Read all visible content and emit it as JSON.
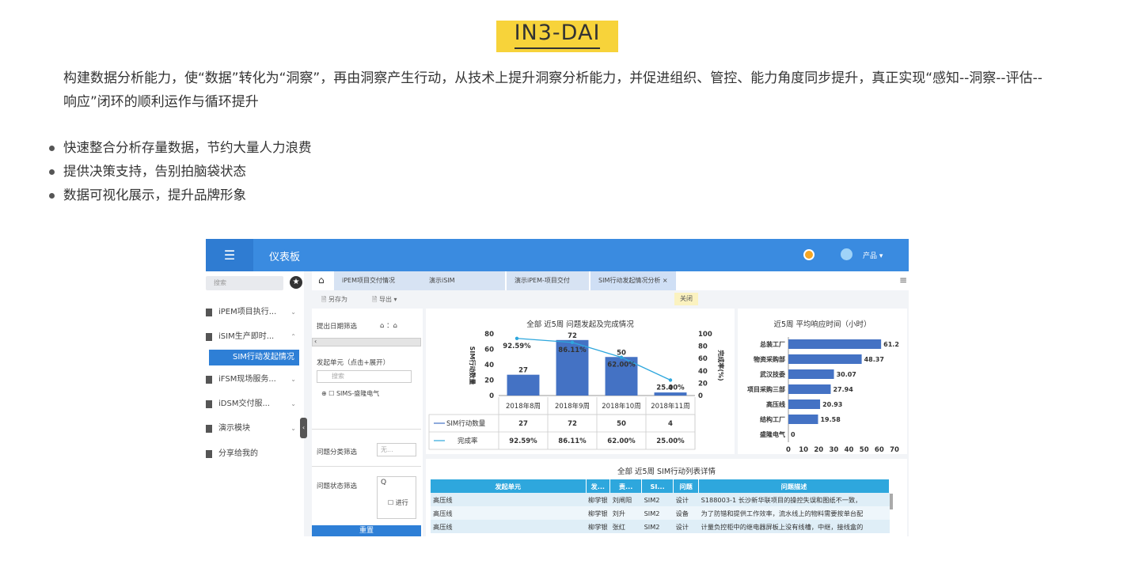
{
  "page": {
    "title": "IN3-DAI",
    "intro": "构建数据分析能力，使“数据”转化为“洞察”，再由洞察产生行动，从技术上提升洞察分析能力，并促进组织、管控、能力角度同步提升，真正实现“感知--洞察--评估--响应”闭环的顺利运作与循环提升",
    "bullets": [
      "快速整合分析存量数据，节约大量人力浪费",
      "提供决策支持，告别拍脑袋状态",
      "数据可视化展示，提升品牌形象"
    ]
  },
  "dashboard": {
    "menu_icon": "☰",
    "app_title": "仪表板",
    "user": "产品 ▾",
    "search_placeholder": "搜索",
    "star_icon": "★",
    "sidebar": [
      {
        "label": "iPEM项目执行...",
        "arrow": "⌄"
      },
      {
        "label": "iSIM生产即时...",
        "arrow": "⌃"
      },
      {
        "label": "SIM行动发起情况分...",
        "arrow": ""
      },
      {
        "label": "iFSM现场服务...",
        "arrow": "⌄"
      },
      {
        "label": "iDSM交付服...",
        "arrow": "⌄"
      },
      {
        "label": "演示模块",
        "arrow": "⌄"
      },
      {
        "label": "分享给我的",
        "arrow": ""
      }
    ],
    "collapse_icon": "‹",
    "home_icon": "⌂",
    "tabs": [
      "iPEM项目交付情况",
      "演示iSIM",
      "演示iPEM-项目交付",
      "SIM行动发起情况分析 ×"
    ],
    "hamburger": "≡",
    "toolbar": {
      "save_as": "🗎 另存为",
      "export": "🗎 导出 ▾"
    },
    "close_label": "关闭",
    "filters": {
      "date_label": "提出日期筛选",
      "date_value": "⌂ ：⌂",
      "scroll_left": "‹",
      "unit_label": "发起单元（点击+展开）",
      "unit_search": "搜索",
      "unit_item": "⊕ ☐ SIMS-盛隆电气",
      "category_label": "问题分类筛选",
      "category_value": "无...",
      "status_label": "问题状态筛选",
      "status_search": "Q",
      "status_item": "☐ 进行",
      "reset": "重置"
    }
  },
  "chart_data": [
    {
      "type": "bar",
      "title": "全部 近5周 问题发起及完成情况",
      "categories": [
        "2018年8周",
        "2018年9周",
        "2018年10周",
        "2018年11周"
      ],
      "series": [
        {
          "name": "SIM行动数量",
          "values": [
            27,
            72,
            50,
            4
          ]
        },
        {
          "name": "完成率",
          "values": [
            92.59,
            86.11,
            62.0,
            25.0
          ]
        }
      ],
      "ylabel": "SIM行动数量",
      "y2label": "完成率(%)",
      "ylim": [
        0,
        80
      ],
      "y2lim": [
        0,
        100
      ],
      "yticks": [
        "0",
        "20",
        "40",
        "60",
        "80"
      ],
      "y2ticks": [
        "0",
        "20",
        "40",
        "60",
        "80",
        "100"
      ],
      "count_labels": [
        "27",
        "72",
        "50",
        "4"
      ],
      "rate_labels": [
        "92.59%",
        "86.11%",
        "62.00%",
        "25.00%"
      ],
      "bar_color": "#4472c4",
      "line_color": "#2ea7dd",
      "legend_placement": "bottom-table"
    },
    {
      "type": "bar",
      "orientation": "horizontal",
      "title": "近5周 平均响应时间（小时）",
      "categories": [
        "总装工厂",
        "物资采购部",
        "武汉技委",
        "项目采购三部",
        "高压线",
        "结构工厂",
        "盛隆电气"
      ],
      "values": [
        61.2,
        48.37,
        30.07,
        27.94,
        20.93,
        19.58,
        0
      ],
      "value_labels": [
        "61.2",
        "48.37",
        "30.07",
        "27.94",
        "20.93",
        "19.58",
        "0"
      ],
      "xlim": [
        0,
        70
      ],
      "xticks": [
        "0",
        "10",
        "20",
        "30",
        "40",
        "50",
        "60",
        "70"
      ],
      "bar_color": "#4472c4"
    }
  ],
  "table": {
    "title": "全部 近5周 SIM行动列表详情",
    "headers": [
      "发起单元",
      "发...",
      "责...",
      "SI...",
      "问题",
      "问题描述"
    ],
    "rows": [
      [
        "高压线",
        "柳学银",
        "刘闸阳",
        "SIM2",
        "设计",
        "S188003-1 长沙新华联项目的操控失误和图纸不一致，"
      ],
      [
        "高压线",
        "柳学银",
        "刘升",
        "SIM2",
        "设备",
        "为了防错和提供工作效率，流水线上的物料需要按单台配"
      ],
      [
        "高压线",
        "柳学银",
        "张红",
        "SIM2",
        "设计",
        "计量负控柜中的继电器屏板上没有线槽，中继，接线盒的"
      ]
    ]
  }
}
